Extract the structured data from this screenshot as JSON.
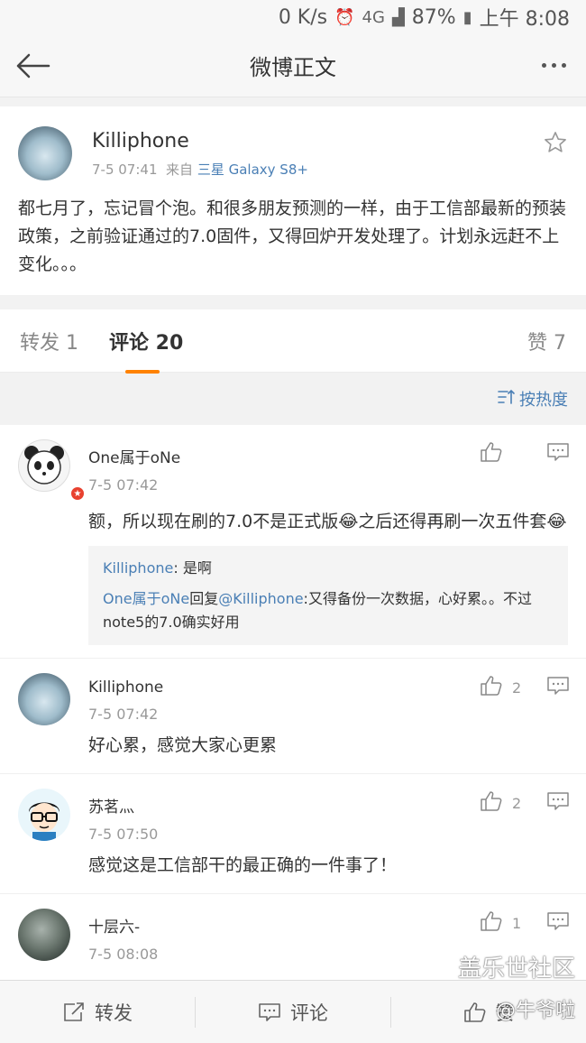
{
  "statusbar": {
    "speed": "0 K/s",
    "network": "4G",
    "battery": "87%",
    "time": "上午 8:08"
  },
  "nav": {
    "title": "微博正文"
  },
  "post": {
    "author": "Killiphone",
    "time": "7-5 07:41",
    "source_prefix": "来自",
    "device": "三星 Galaxy S8+",
    "text": "都七月了，忘记冒个泡。和很多朋友预测的一样，由于工信部最新的预装政策，之前验证通过的7.0固件，又得回炉开发处理了。计划永远赶不上变化。。。"
  },
  "tabs": {
    "repost": "转发 1",
    "comment": "评论 20",
    "like": "赞 7"
  },
  "sort": {
    "label": "按热度"
  },
  "comments": [
    {
      "name": "One属于oNe",
      "time": "7-5 07:42",
      "text": "额，所以现在刷的7.0不是正式版😂之后还得再刷一次五件套😂",
      "likes": "",
      "replies": [
        {
          "user": "Killiphone",
          "sep": ": ",
          "text": "是啊"
        },
        {
          "user": "One属于oNe",
          "mid": "回复",
          "at": "@Killiphone",
          "sep": ":",
          "text": "又得备份一次数据，心好累。。不过note5的7.0确实好用"
        }
      ]
    },
    {
      "name": "Killiphone",
      "time": "7-5 07:42",
      "text": "好心累，感觉大家心更累",
      "likes": "2"
    },
    {
      "name": "苏茗灬",
      "time": "7-5 07:50",
      "text": "感觉这是工信部干的最正确的一件事了！",
      "likes": "2"
    },
    {
      "name": "十层六-",
      "time": "7-5 08:08",
      "text": "",
      "likes": "1"
    }
  ],
  "bottombar": {
    "repost": "转发",
    "comment": "评论",
    "like": "赞"
  },
  "watermark": {
    "line1": "盖乐世社区",
    "line2": "@牛爷啦"
  }
}
